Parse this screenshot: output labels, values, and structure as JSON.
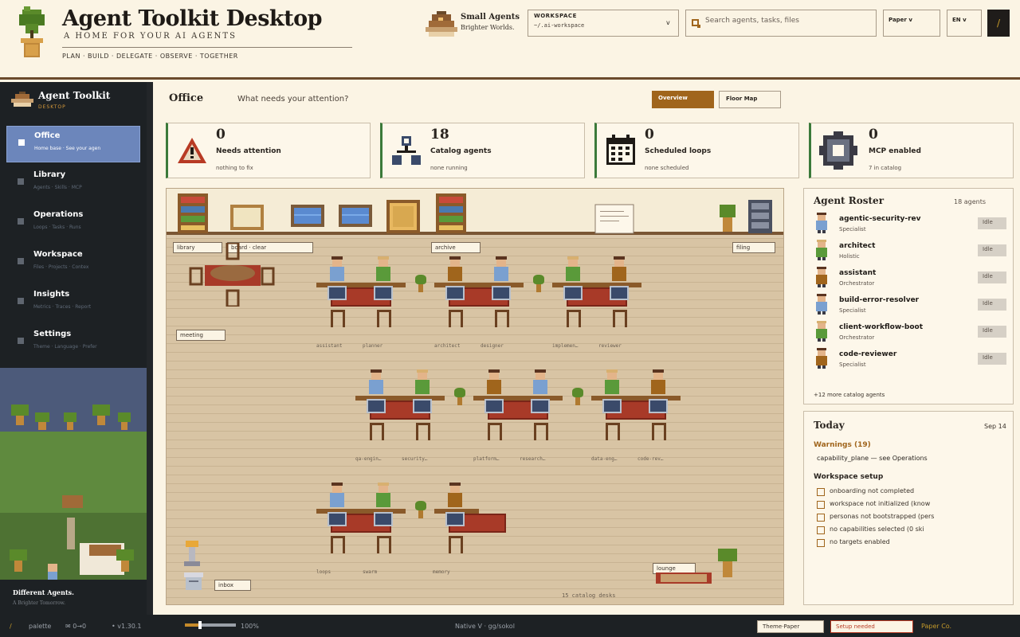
{
  "header": {
    "title": "Agent Toolkit Desktop",
    "subtitle": "A HOME FOR YOUR AI AGENTS",
    "tagline": "PLAN · BUILD · DELEGATE · OBSERVE · TOGETHER",
    "brand_name": "Small Agents",
    "brand_tag": "Brighter Worlds.",
    "workspace_label": "WORKSPACE",
    "workspace_path": "~/.ai-workspace",
    "workspace_chevron": "v",
    "search_placeholder": "Search agents, tasks, files",
    "theme_select": "Paper v",
    "lang_select": "EN v",
    "dark_button": "/"
  },
  "sidebar": {
    "app_title": "Agent Toolkit",
    "app_sub": "DESKTOP",
    "items": [
      {
        "label": "Office",
        "desc": "Home base · See your agen"
      },
      {
        "label": "Library",
        "desc": "Agents · Skills · MCP"
      },
      {
        "label": "Operations",
        "desc": "Loops · Tasks · Runs"
      },
      {
        "label": "Workspace",
        "desc": "Files · Projects · Contex"
      },
      {
        "label": "Insights",
        "desc": "Metrics · Traces · Report"
      },
      {
        "label": "Settings",
        "desc": "Theme · Language · Prefer"
      }
    ],
    "footer_line1": "Different Agents.",
    "footer_line2": "A Brighter Tomorrow."
  },
  "office": {
    "title": "Office",
    "question": "What needs your attention?",
    "tabs": [
      "Overview",
      "Floor Map"
    ]
  },
  "stats": [
    {
      "value": "0",
      "label": "Needs attention",
      "note": "nothing to fix",
      "icon": "warning-icon"
    },
    {
      "value": "18",
      "label": "Catalog agents",
      "note": "none running",
      "icon": "network-icon"
    },
    {
      "value": "0",
      "label": "Scheduled loops",
      "note": "none scheduled",
      "icon": "calendar-icon"
    },
    {
      "value": "0",
      "label": "MCP enabled",
      "note": "7 in catalog",
      "icon": "gear-icon"
    }
  ],
  "map": {
    "zones": {
      "library": "library",
      "board": "board · clear",
      "archive": "archive",
      "filing": "filing",
      "meeting": "meeting",
      "lounge": "lounge",
      "inbox": "inbox"
    },
    "desk_labels": [
      "assistant",
      "planner",
      "architect",
      "designer",
      "implemen…",
      "reviewer",
      "qa-engin…",
      "security…",
      "platform…",
      "research…",
      "data-eng…",
      "code-rev…",
      "loops",
      "swarm",
      "memory"
    ],
    "footer": "15 catalog desks"
  },
  "roster": {
    "title": "Agent Roster",
    "count": "18 agents",
    "agents": [
      {
        "name": "agentic-security-rev",
        "role": "Specialist",
        "status": "Idle"
      },
      {
        "name": "architect",
        "role": "Holistic",
        "status": "Idle"
      },
      {
        "name": "assistant",
        "role": "Orchestrator",
        "status": "Idle"
      },
      {
        "name": "build-error-resolver",
        "role": "Specialist",
        "status": "Idle"
      },
      {
        "name": "client-workflow-boot",
        "role": "Orchestrator",
        "status": "Idle"
      },
      {
        "name": "code-reviewer",
        "role": "Specialist",
        "status": "Idle"
      }
    ],
    "more": "+12 more catalog agents"
  },
  "today": {
    "title": "Today",
    "date": "Sep 14",
    "warnings": "Warnings (19)",
    "warning_msg": "capability_plane — see Operations",
    "setup_title": "Workspace setup",
    "setup_items": [
      "onboarding not completed",
      "workspace not initialized (know",
      "personas not bootstrapped (pers",
      "no capabilities selected (0 ski",
      "no targets enabled"
    ]
  },
  "statusbar": {
    "slash": "/",
    "palette": "palette",
    "shortcut": "✉ 0→0",
    "version": "• v1.30.1",
    "zoom_fraction": 0.3,
    "zoom_label": "100%",
    "engine": "Native V · gg/sokol",
    "theme": "Theme·Paper",
    "setup": "Setup needed",
    "company": "Paper Co."
  },
  "colors": {
    "accent": "#a0651c",
    "nav_active": "#6c86bb",
    "sidebar_bg": "#1d2124",
    "paper": "#fbf4e4",
    "stat_border": "#3b7a3a"
  }
}
